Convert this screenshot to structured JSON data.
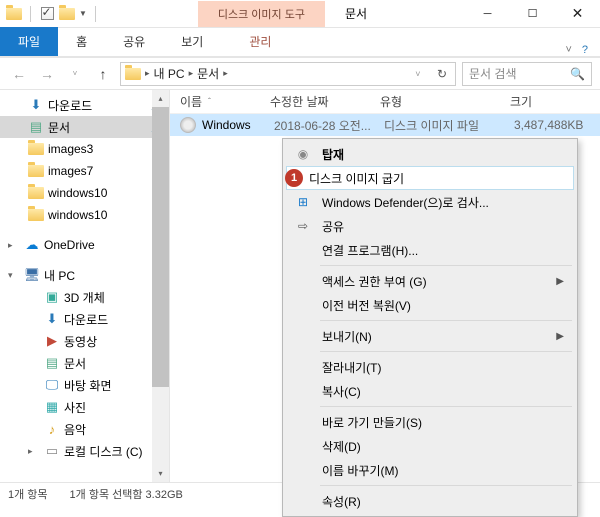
{
  "titlebar": {
    "contextual_tool": "디스크 이미지 도구",
    "title": "문서"
  },
  "ribbon": {
    "file": "파일",
    "home": "홈",
    "share": "공유",
    "view": "보기",
    "manage": "관리"
  },
  "address": {
    "crumb1": "내 PC",
    "crumb2": "문서",
    "search_placeholder": "문서 검색"
  },
  "tree": {
    "downloads": "다운로드",
    "documents": "문서",
    "images3": "images3",
    "images7": "images7",
    "windows10a": "windows10",
    "windows10b": "windows10",
    "onedrive": "OneDrive",
    "thispc": "내 PC",
    "objects3d": "3D 개체",
    "downloads2": "다운로드",
    "videos": "동영상",
    "documents2": "문서",
    "desktop": "바탕 화면",
    "pictures": "사진",
    "music": "음악",
    "localdisk": "로컬 디스크 (C)"
  },
  "columns": {
    "name": "이름",
    "date": "수정한 날짜",
    "type": "유형",
    "size": "크기"
  },
  "file": {
    "name": "Windows",
    "date": "2018-06-28 오전...",
    "type": "디스크 이미지 파일",
    "size": "3,487,488KB"
  },
  "context": {
    "marker": "1",
    "mount": "탑재",
    "burn": "디스크 이미지 굽기",
    "defender": "Windows Defender(으)로 검사...",
    "share": "공유",
    "openwith": "연결 프로그램(H)...",
    "access": "액세스 권한 부여 (G)",
    "restore": "이전 버전 복원(V)",
    "sendto": "보내기(N)",
    "cut": "잘라내기(T)",
    "copy": "복사(C)",
    "shortcut": "바로 가기 만들기(S)",
    "delete": "삭제(D)",
    "rename": "이름 바꾸기(M)",
    "properties": "속성(R)"
  },
  "status": {
    "count": "1개 항목",
    "selection": "1개 항목 선택함 3.32GB"
  }
}
